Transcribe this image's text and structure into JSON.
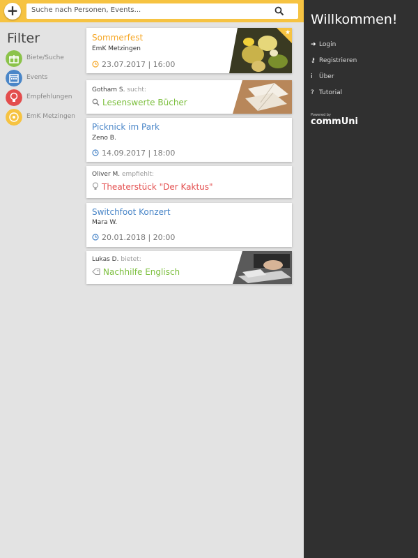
{
  "header": {
    "add_label": "+",
    "search_placeholder": "Suche nach Personen, Events..."
  },
  "filter": {
    "title": "Filter",
    "items": [
      {
        "label": "Biete/Suche",
        "icon": "gift-icon",
        "color": "#8bc34a"
      },
      {
        "label": "Events",
        "icon": "calendar-icon",
        "color": "#4a86c8"
      },
      {
        "label": "Empfehlungen",
        "icon": "lightbulb-icon",
        "color": "#e34d4d"
      },
      {
        "label": "EmK Metzingen",
        "icon": "community-icon",
        "color": "#f6c342"
      }
    ]
  },
  "feed": [
    {
      "type": "event",
      "title": "Sommerfest",
      "subtitle": "EmK Metzingen",
      "datetime": "23.07.2017 | 16:00",
      "title_color": "#f6a623",
      "starred": true
    },
    {
      "type": "post",
      "user": "Gotham S.",
      "verb": "sucht:",
      "headline": "Lesenswerte Bücher",
      "color": "#7cbf3e",
      "icon": "search-icon"
    },
    {
      "type": "event",
      "title": "Picknick im Park",
      "subtitle": "Zeno B.",
      "datetime": "14.09.2017 | 18:00",
      "title_color": "#4a86c8"
    },
    {
      "type": "post",
      "user": "Oliver M.",
      "verb": "empfiehlt:",
      "headline": "Theaterstück \"Der Kaktus\"",
      "color": "#e34d4d",
      "icon": "lightbulb-icon"
    },
    {
      "type": "event",
      "title": "Switchfoot Konzert",
      "subtitle": "Mara W.",
      "datetime": "20.01.2018 | 20:00",
      "title_color": "#4a86c8"
    },
    {
      "type": "post",
      "user": "Lukas D.",
      "verb": "bietet:",
      "headline": "Nachhilfe Englisch",
      "color": "#7cbf3e",
      "icon": "tag-icon"
    }
  ],
  "sidebar": {
    "title": "Willkommen!",
    "items": [
      {
        "label": "Login",
        "icon": "login-icon",
        "glyph": "➜"
      },
      {
        "label": "Registrieren",
        "icon": "key-icon",
        "glyph": "⚷"
      },
      {
        "label": "Über",
        "icon": "info-icon",
        "glyph": "i"
      },
      {
        "label": "Tutorial",
        "icon": "help-icon",
        "glyph": "?"
      }
    ],
    "powered_by": "Powered by",
    "brand": "commUni"
  }
}
